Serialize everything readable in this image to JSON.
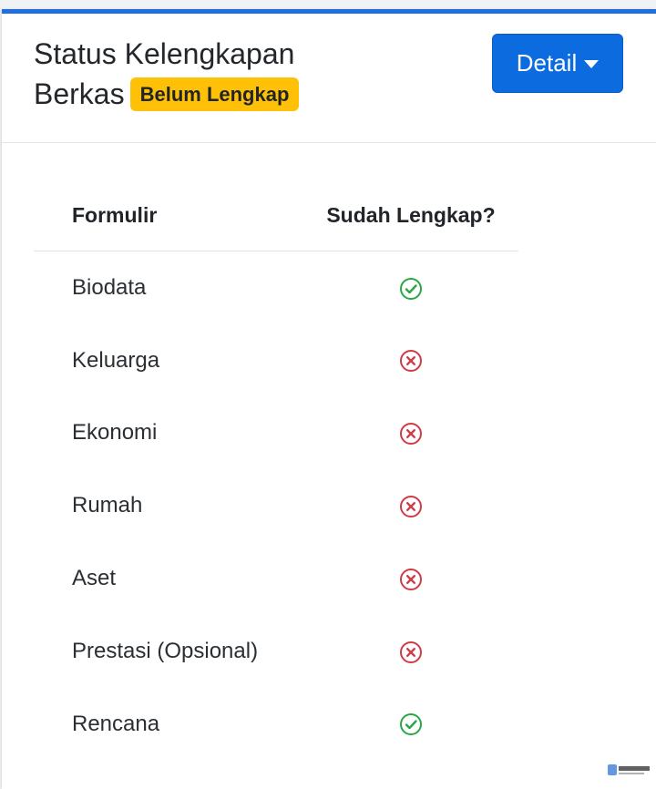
{
  "header": {
    "title_line1": "Status Kelengkapan",
    "title_line2": "Berkas",
    "badge": "Belum Lengkap",
    "detail_button": "Detail"
  },
  "table": {
    "columns": [
      "Formulir",
      "Sudah Lengkap?"
    ],
    "rows": [
      {
        "form": "Biodata",
        "complete": true
      },
      {
        "form": "Keluarga",
        "complete": false
      },
      {
        "form": "Ekonomi",
        "complete": false
      },
      {
        "form": "Rumah",
        "complete": false
      },
      {
        "form": "Aset",
        "complete": false
      },
      {
        "form": "Prestasi (Opsional)",
        "complete": false
      },
      {
        "form": "Rencana",
        "complete": true
      }
    ]
  },
  "colors": {
    "accent": "#0d6be0",
    "badge": "#ffc107",
    "success": "#28a745",
    "danger": "#d13a45"
  },
  "icons": {
    "complete": "check-circle-icon",
    "incomplete": "x-circle-icon",
    "dropdown": "caret-down-icon"
  }
}
